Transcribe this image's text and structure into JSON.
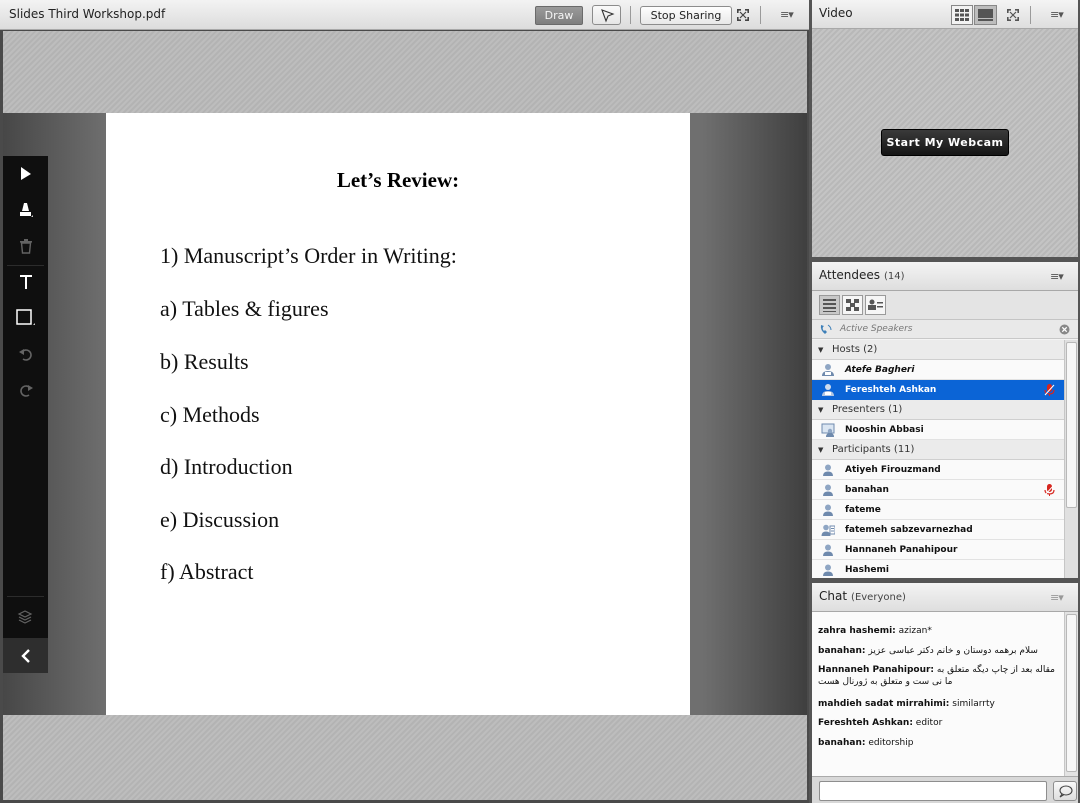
{
  "share_pod": {
    "title": "Slides Third Workshop.pdf",
    "draw_label": "Draw",
    "stop_sharing_label": "Stop Sharing",
    "menu_glyph": "≡▾"
  },
  "slide": {
    "title": "Let’s Review:",
    "lines": [
      "1) Manuscript’s Order in Writing:",
      "a) Tables & figures",
      "b) Results",
      "c) Methods",
      "d) Introduction",
      "e) Discussion",
      "f) Abstract"
    ]
  },
  "draw_tools": [
    "pointer-icon",
    "highlighter-icon",
    "trash-icon",
    "text-tool-icon",
    "shape-tool-icon",
    "undo-icon",
    "redo-icon",
    "layers-icon",
    "collapse-icon"
  ],
  "video_pod": {
    "title": "Video",
    "webcam_button": "Start My Webcam",
    "menu_glyph": "≡▾"
  },
  "attendees_pod": {
    "title": "Attendees",
    "count": "(14)",
    "active_speakers": "Active Speakers",
    "menu_glyph": "≡▾",
    "groups": {
      "hosts": {
        "label": "Hosts (2)",
        "members": [
          "Atefe Bagheri",
          "Fereshteh Ashkan"
        ]
      },
      "presenters": {
        "label": "Presenters (1)",
        "members": [
          "Nooshin Abbasi"
        ]
      },
      "participants": {
        "label": "Participants (11)",
        "members": [
          "Atiyeh Firouzmand",
          "banahan",
          "fateme",
          "fatemeh sabzevarnezhad",
          "Hannaneh Panahipour",
          "Hashemi"
        ]
      }
    }
  },
  "chat_pod": {
    "title": "Chat",
    "scope": "(Everyone)",
    "menu_glyph": "≡▾",
    "messages": [
      {
        "sender": "zahra hashemi:",
        "text": " azizan*"
      },
      {
        "sender": "banahan:",
        "text": " سلام برهمه دوستان و خانم دکتر عباسی عزیز"
      },
      {
        "sender": "Hannaneh Panahipour:",
        "text": " مقاله بعد از چاپ دیگه متعلق به ما نی ست و متعلق به ژورنال هست"
      },
      {
        "sender": "mahdieh sadat mirrahimi:",
        "text": " similarrty"
      },
      {
        "sender": "Fereshteh Ashkan:",
        "text": " editor"
      },
      {
        "sender": "banahan:",
        "text": " editorship"
      }
    ]
  },
  "colors": {
    "selected_row": "#0b64d6",
    "mic_red": "#d6261f",
    "toolbar_bg": "#0f0f0f"
  }
}
